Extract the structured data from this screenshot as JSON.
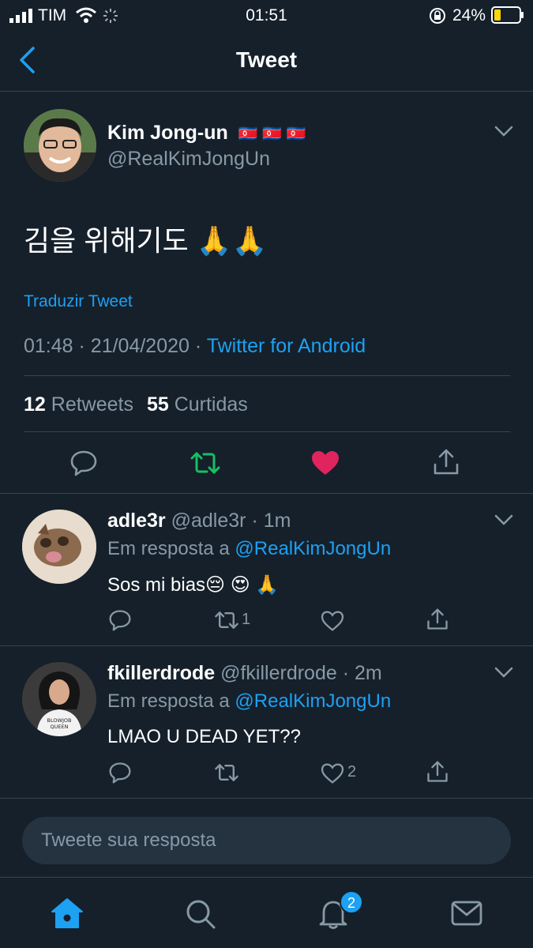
{
  "status_bar": {
    "carrier": "TIM",
    "time": "01:51",
    "battery": "24%"
  },
  "nav": {
    "title": "Tweet"
  },
  "main_tweet": {
    "author_name": "Kim Jong-un",
    "flags": "🇰🇵 🇰🇵 🇰🇵",
    "handle": "@RealKimJongUn",
    "text": "김을 위해기도 🙏🙏",
    "translate_label": "Traduzir Tweet",
    "time": "01:48",
    "sep1": "·",
    "date": "21/04/2020",
    "sep2": "·",
    "client": "Twitter for Android",
    "retweet_count": "12",
    "retweet_label": "Retweets",
    "like_count": "55",
    "like_label": "Curtidas"
  },
  "replies": [
    {
      "author_name": "adle3r",
      "handle": "@adle3r",
      "age": "· 1m",
      "replying_prefix": "Em resposta a",
      "replying_to": "@RealKimJongUn",
      "text": "Sos mi bias😔 😍 🙏",
      "retweets": "1",
      "likes": ""
    },
    {
      "author_name": "fkillerdrode",
      "handle": "@fkillerdrode",
      "age": "· 2m",
      "replying_prefix": "Em resposta a",
      "replying_to": "@RealKimJongUn",
      "text": "LMAO U DEAD YET??",
      "retweets": "",
      "likes": "2",
      "avatar_shirt_text": "BLOWJOB QUEEN"
    }
  ],
  "reply_input": {
    "placeholder": "Tweete sua resposta"
  },
  "tab_bar": {
    "notifications_badge": "2"
  },
  "colors": {
    "background": "#15202b",
    "accent": "#1da1f2",
    "muted": "#8899a6",
    "retweet_active": "#17bf63",
    "like_active": "#e0245e",
    "divider": "#38444d"
  },
  "icons": [
    "back-arrow-icon",
    "chevron-down-icon",
    "reply-icon",
    "retweet-icon",
    "like-icon",
    "share-icon",
    "home-icon",
    "search-icon",
    "notifications-icon",
    "messages-icon",
    "wifi-icon",
    "signal-icon",
    "battery-icon",
    "orientation-lock-icon"
  ]
}
